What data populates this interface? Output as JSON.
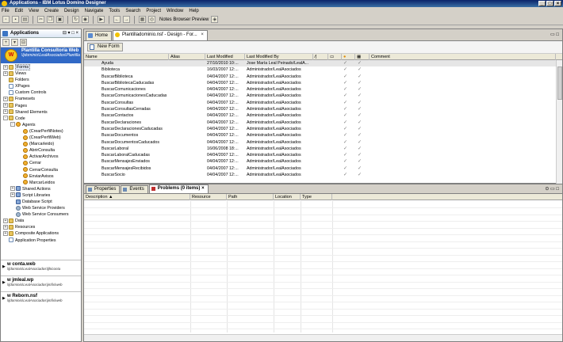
{
  "window": {
    "title": "Applications - IBM Lotus Domino Designer",
    "controls": [
      "_",
      "□",
      "×"
    ]
  },
  "menu": [
    "File",
    "Edit",
    "View",
    "Create",
    "Design",
    "Navigate",
    "Tools",
    "Search",
    "Project",
    "Window",
    "Help"
  ],
  "toolbar": {
    "preview_label": "Notes Browser Preview"
  },
  "navigator": {
    "title": "Applications",
    "app_name": "Plantilla Consultoría Web",
    "app_path": "\\ljdominio\\LealAsociados\\Plantilla",
    "tree": [
      {
        "label": "Forms",
        "indent": 0,
        "toggle": "+",
        "icon": "folder",
        "selected": true
      },
      {
        "label": "Views",
        "indent": 0,
        "toggle": "+",
        "icon": "folder"
      },
      {
        "label": "Folders",
        "indent": 0,
        "toggle": "",
        "icon": "folder"
      },
      {
        "label": "XPages",
        "indent": 0,
        "toggle": "",
        "icon": "page"
      },
      {
        "label": "Custom Controls",
        "indent": 0,
        "toggle": "",
        "icon": "page"
      },
      {
        "label": "Framesets",
        "indent": 0,
        "toggle": "+",
        "icon": "folder"
      },
      {
        "label": "Pages",
        "indent": 0,
        "toggle": "+",
        "icon": "folder"
      },
      {
        "label": "Shared Elements",
        "indent": 0,
        "toggle": "+",
        "icon": "folder"
      },
      {
        "label": "Code",
        "indent": 0,
        "toggle": "-",
        "icon": "folder"
      },
      {
        "label": "Agents",
        "indent": 1,
        "toggle": "-",
        "icon": "agent"
      },
      {
        "label": "(CrearPerfilNotes)",
        "indent": 2,
        "toggle": "",
        "icon": "agent"
      },
      {
        "label": "(CrearPerfilWeb)",
        "indent": 2,
        "toggle": "",
        "icon": "agent"
      },
      {
        "label": "(Marcarleido)",
        "indent": 2,
        "toggle": "",
        "icon": "agent"
      },
      {
        "label": "AbrirConsulta",
        "indent": 2,
        "toggle": "",
        "icon": "agent"
      },
      {
        "label": "ActivarArchivos",
        "indent": 2,
        "toggle": "",
        "icon": "agent"
      },
      {
        "label": "Cerrar",
        "indent": 2,
        "toggle": "",
        "icon": "agent"
      },
      {
        "label": "CerrarConsulta",
        "indent": 2,
        "toggle": "",
        "icon": "agent"
      },
      {
        "label": "EnviarAvisos",
        "indent": 2,
        "toggle": "",
        "icon": "agent"
      },
      {
        "label": "MarcarLeidos",
        "indent": 2,
        "toggle": "",
        "icon": "agent"
      },
      {
        "label": "Shared Actions",
        "indent": 1,
        "toggle": "+",
        "icon": "code"
      },
      {
        "label": "Script Libraries",
        "indent": 1,
        "toggle": "+",
        "icon": "code"
      },
      {
        "label": "Database Script",
        "indent": 1,
        "toggle": "",
        "icon": "code"
      },
      {
        "label": "Web Service Providers",
        "indent": 1,
        "toggle": "",
        "icon": "gear"
      },
      {
        "label": "Web Service Consumers",
        "indent": 1,
        "toggle": "",
        "icon": "gear"
      },
      {
        "label": "Data",
        "indent": 0,
        "toggle": "+",
        "icon": "folder"
      },
      {
        "label": "Resources",
        "indent": 0,
        "toggle": "+",
        "icon": "folder"
      },
      {
        "label": "Composite Applications",
        "indent": 0,
        "toggle": "+",
        "icon": "folder"
      },
      {
        "label": "Application Properties",
        "indent": 0,
        "toggle": "",
        "icon": "page"
      }
    ],
    "workspaces": [
      {
        "name": "w conta.web",
        "path": "\\ljdominio\\LealAsociados\\ljhiconta"
      },
      {
        "name": "w jmleal.wp",
        "path": "\\ljdominio\\LealAsociados\\jmfix\\web"
      },
      {
        "name": "w Reborn.nsf",
        "path": "\\ljdominio\\LealAsociados\\jmfix\\web"
      }
    ]
  },
  "editor": {
    "tabs": [
      {
        "label": "Home",
        "active": false
      },
      {
        "label": "Plantilladominio.nsf - Design - For...",
        "active": true
      }
    ],
    "new_form_label": "New Form",
    "columns": [
      "Name",
      "Alias",
      "Last Modified",
      "Last Modified By",
      "",
      "",
      "",
      "",
      "Comment"
    ],
    "rows": [
      {
        "name": "Ayuda",
        "alias": "",
        "modified": "27/10/2010 10:...",
        "by": "Jose María Leal Peinado/LealA...",
        "c1": "✓",
        "c2": "✓",
        "sel": true
      },
      {
        "name": "Biblioteca",
        "alias": "",
        "modified": "16/03/2007 12:...",
        "by": "Administrador/LealAsociados",
        "c1": "✓",
        "c2": "✓"
      },
      {
        "name": "BuscarBiblioteca",
        "alias": "",
        "modified": "04/04/2007 12:...",
        "by": "Administrador/LealAsociados",
        "c1": "✓",
        "c2": "✓"
      },
      {
        "name": "BuscarBibliotecaCaducadas",
        "alias": "",
        "modified": "04/04/2007 12:...",
        "by": "Administrador/LealAsociados",
        "c1": "✓",
        "c2": "✓"
      },
      {
        "name": "BuscarComunicaciones",
        "alias": "",
        "modified": "04/04/2007 12:...",
        "by": "Administrador/LealAsociados",
        "c1": "✓",
        "c2": "✓"
      },
      {
        "name": "BuscarComunicacionesCaducadas",
        "alias": "",
        "modified": "04/04/2007 12:...",
        "by": "Administrador/LealAsociados",
        "c1": "✓",
        "c2": "✓"
      },
      {
        "name": "BuscarConsultas",
        "alias": "",
        "modified": "04/04/2007 12:...",
        "by": "Administrador/LealAsociados",
        "c1": "✓",
        "c2": "✓"
      },
      {
        "name": "BuscarConsultasCerradas",
        "alias": "",
        "modified": "04/04/2007 12:...",
        "by": "Administrador/LealAsociados",
        "c1": "✓",
        "c2": "✓"
      },
      {
        "name": "BuscarContactos",
        "alias": "",
        "modified": "04/04/2007 12:...",
        "by": "Administrador/LealAsociados",
        "c1": "✓",
        "c2": "✓"
      },
      {
        "name": "BuscarDeclaraciones",
        "alias": "",
        "modified": "04/04/2007 12:...",
        "by": "Administrador/LealAsociados",
        "c1": "✓",
        "c2": "✓"
      },
      {
        "name": "BuscarDeclaracionesCaducadas",
        "alias": "",
        "modified": "04/04/2007 12:...",
        "by": "Administrador/LealAsociados",
        "c1": "✓",
        "c2": "✓"
      },
      {
        "name": "BuscarDocumentos",
        "alias": "",
        "modified": "04/04/2007 12:...",
        "by": "Administrador/LealAsociados",
        "c1": "✓",
        "c2": "✓"
      },
      {
        "name": "BuscarDocumentosCaducados",
        "alias": "",
        "modified": "04/04/2007 12:...",
        "by": "Administrador/LealAsociados",
        "c1": "✓",
        "c2": "✓"
      },
      {
        "name": "BuscarLaboral",
        "alias": "",
        "modified": "16/06/2008 18:...",
        "by": "Administrador/LealAsociados",
        "c1": "✓",
        "c2": "✓"
      },
      {
        "name": "BuscarLaboralCaducadas",
        "alias": "",
        "modified": "04/04/2007 12:...",
        "by": "Administrador/LealAsociados",
        "c1": "✓",
        "c2": "✓"
      },
      {
        "name": "BuscarMensajesEnviados",
        "alias": "",
        "modified": "04/04/2007 12:...",
        "by": "Administrador/LealAsociados",
        "c1": "✓",
        "c2": "✓"
      },
      {
        "name": "BuscarMensajesRecibidos",
        "alias": "",
        "modified": "04/04/2007 12:...",
        "by": "Administrador/LealAsociados",
        "c1": "✓",
        "c2": "✓"
      },
      {
        "name": "BuscarSocio",
        "alias": "",
        "modified": "04/04/2007 12:...",
        "by": "Administrador/LealAsociados",
        "c1": "✓",
        "c2": "✓"
      }
    ]
  },
  "problems": {
    "tabs": [
      {
        "label": "Properties",
        "active": false
      },
      {
        "label": "Events",
        "active": false
      },
      {
        "label": "Problems (0 items)",
        "active": true
      }
    ],
    "columns": [
      "Description",
      "Resource",
      "Path",
      "Location",
      "Type"
    ]
  }
}
